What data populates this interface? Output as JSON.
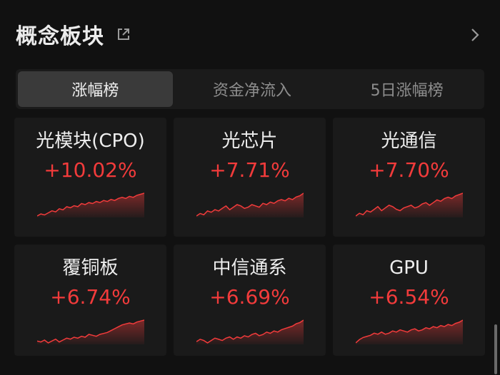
{
  "header": {
    "title": "概念板块"
  },
  "tabs": [
    {
      "label": "涨幅榜",
      "active": true
    },
    {
      "label": "资金净流入",
      "active": false
    },
    {
      "label": "5日涨幅榜",
      "active": false
    }
  ],
  "colors": {
    "up": "#f23b3b",
    "background": "#111111",
    "card": "#1a1a1a"
  },
  "cards": [
    {
      "name": "光模块(CPO)",
      "change": "+10.02%",
      "trend": [
        3,
        5,
        4,
        6,
        8,
        7,
        10,
        9,
        12,
        11,
        13,
        12,
        15,
        14,
        16,
        15,
        17,
        16,
        18,
        17,
        19,
        18,
        20,
        21,
        20,
        22,
        21,
        23,
        24,
        25
      ]
    },
    {
      "name": "光芯片",
      "change": "+7.71%",
      "trend": [
        4,
        6,
        5,
        8,
        7,
        9,
        8,
        10,
        12,
        9,
        11,
        13,
        12,
        10,
        11,
        13,
        12,
        11,
        14,
        13,
        15,
        14,
        16,
        17,
        16,
        18,
        17,
        19,
        20,
        22
      ]
    },
    {
      "name": "光通信",
      "change": "+7.70%",
      "trend": [
        5,
        7,
        6,
        9,
        8,
        10,
        12,
        9,
        11,
        13,
        12,
        10,
        9,
        11,
        12,
        13,
        11,
        12,
        14,
        15,
        13,
        15,
        17,
        16,
        18,
        19,
        18,
        20,
        21,
        22
      ]
    },
    {
      "name": "覆铜板",
      "change": "+6.74%",
      "trend": [
        5,
        4,
        6,
        3,
        5,
        7,
        4,
        6,
        8,
        7,
        9,
        8,
        10,
        9,
        12,
        11,
        10,
        12,
        13,
        14,
        16,
        18,
        20,
        22,
        23,
        24,
        23,
        25,
        26,
        27
      ]
    },
    {
      "name": "中信通系",
      "change": "+6.69%",
      "trend": [
        6,
        8,
        7,
        5,
        7,
        9,
        8,
        7,
        9,
        10,
        8,
        10,
        9,
        11,
        10,
        12,
        13,
        11,
        12,
        14,
        13,
        15,
        14,
        16,
        17,
        18,
        19,
        21,
        22,
        24
      ]
    },
    {
      "name": "GPU",
      "change": "+6.54%",
      "trend": [
        3,
        6,
        8,
        9,
        10,
        12,
        11,
        13,
        11,
        12,
        14,
        13,
        15,
        14,
        13,
        15,
        16,
        14,
        15,
        17,
        16,
        18,
        17,
        19,
        18,
        20,
        19,
        21,
        22,
        24
      ]
    }
  ]
}
